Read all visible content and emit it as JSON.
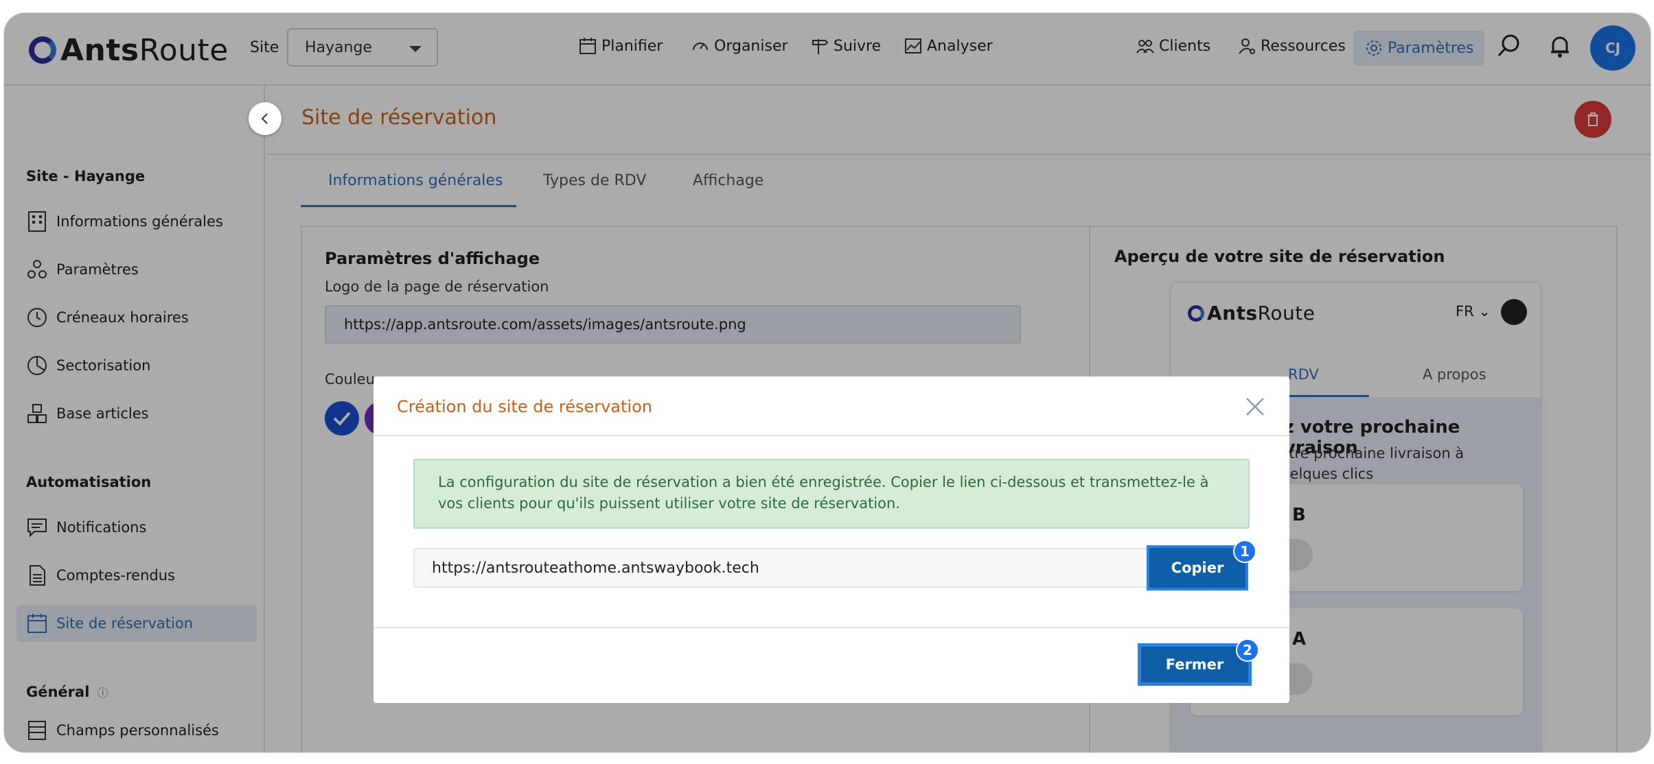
{
  "app": {
    "logo_bold": "Ants",
    "logo_light": "Route"
  },
  "header": {
    "site_label": "Site",
    "site_value": "Hayange",
    "nav": [
      "Planifier",
      "Organiser",
      "Suivre",
      "Analyser"
    ],
    "right_nav": [
      "Clients",
      "Ressources",
      "Paramètres"
    ],
    "avatar_initials": "CJ"
  },
  "sidebar": {
    "section1": "Site - Hayange",
    "items1": [
      "Informations générales",
      "Paramètres",
      "Créneaux horaires",
      "Sectorisation",
      "Base articles"
    ],
    "section2": "Automatisation",
    "items2": [
      "Notifications",
      "Comptes-rendus",
      "Site de réservation"
    ],
    "section3": "Général",
    "items3": [
      "Champs personnalisés"
    ]
  },
  "page": {
    "title": "Site de réservation",
    "tabs": [
      "Informations générales",
      "Types de RDV",
      "Affichage"
    ],
    "display_title": "Paramètres d'affichage",
    "logo_label": "Logo de la page de réservation",
    "logo_url": "https://app.antsroute.com/assets/images/antsroute.png",
    "color_label_partial": "Couleu",
    "preview_title": "Aperçu de votre site de réservation"
  },
  "preview": {
    "lang": "FR",
    "tab_partial": "RDV",
    "tab_about": "A propos",
    "heading_partial": "ez votre prochaine livraison",
    "sub_line1": "votre prochaine livraison à",
    "sub_line2": "quelques clics",
    "card1_letter": "B",
    "card2_letter": "A"
  },
  "modal": {
    "title": "Création du site de réservation",
    "message": "La configuration du site de réservation a bien été enregistrée. Copier le lien ci-dessous et transmettez-le à vos clients pour qu'ils puissent utiliser votre site de réservation.",
    "link": "https://antsrouteathome.antswaybook.tech",
    "copy_label": "Copier",
    "close_label": "Fermer",
    "badge1": "1",
    "badge2": "2"
  }
}
